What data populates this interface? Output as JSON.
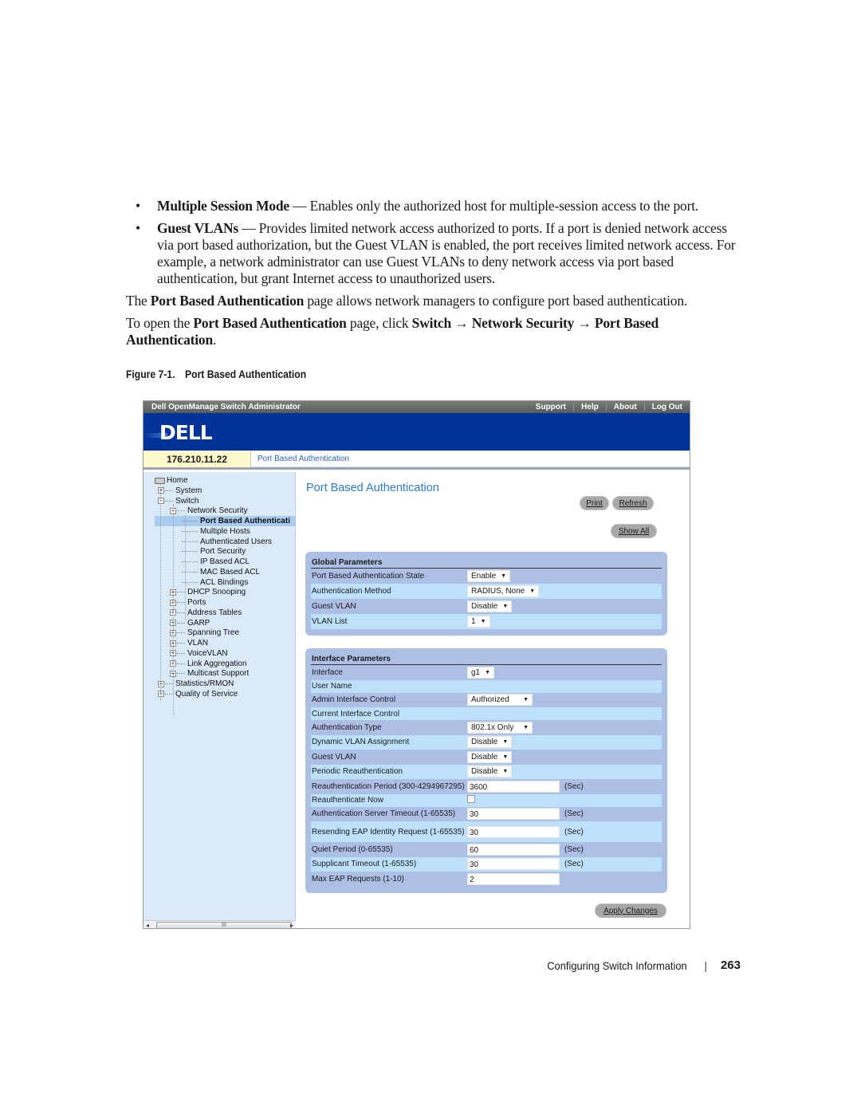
{
  "document": {
    "bullets": [
      {
        "term": "Multiple Session Mode",
        "text": " — Enables only the authorized host for multiple-session access to the port."
      },
      {
        "term": "Guest VLANs",
        "text": " — Provides limited network access authorized to ports. If a port is denied network access via port based authorization, but the Guest VLAN is enabled, the port receives limited network access. For example, a network administrator can use Guest VLANs to deny network access via port based authentication, but grant Internet access to unauthorized users."
      }
    ],
    "para1": {
      "prefix": "The ",
      "bold": "Port Based Authentication",
      "suffix": " page allows network managers to configure port based authentication."
    },
    "para2": {
      "prefix": "To open the ",
      "bold1": "Port Based Authentication",
      "mid": " page, click ",
      "path1": "Switch",
      "arrow": " → ",
      "path2": "Network Security",
      "path3": "Port Based Authentication",
      "end": "."
    },
    "figure_number": "Figure 7-1.",
    "figure_title": "Port Based Authentication"
  },
  "app": {
    "title": "Dell OpenManage Switch Administrator",
    "top_links": [
      "Support",
      "Help",
      "About",
      "Log Out"
    ],
    "logo": "DELL",
    "ip_address": "176.210.11.22",
    "breadcrumb": "Port Based Authentication"
  },
  "tree": {
    "items": [
      {
        "label": "Home",
        "level": 0,
        "icon": "home-icon"
      },
      {
        "label": "System",
        "level": 1,
        "expander": "+"
      },
      {
        "label": "Switch",
        "level": 1,
        "expander": "−"
      },
      {
        "label": "Network Security",
        "level": 2,
        "expander": "−"
      },
      {
        "label": "Port Based Authenticati",
        "level": 3,
        "selected": true
      },
      {
        "label": "Multiple Hosts",
        "level": 3
      },
      {
        "label": "Authenticated Users",
        "level": 3
      },
      {
        "label": "Port Security",
        "level": 3
      },
      {
        "label": "IP Based ACL",
        "level": 3
      },
      {
        "label": "MAC Based ACL",
        "level": 3
      },
      {
        "label": "ACL Bindings",
        "level": 3
      },
      {
        "label": "DHCP Snooping",
        "level": 2,
        "expander": "+"
      },
      {
        "label": "Ports",
        "level": 2,
        "expander": "+"
      },
      {
        "label": "Address Tables",
        "level": 2,
        "expander": "+"
      },
      {
        "label": "GARP",
        "level": 2,
        "expander": "+"
      },
      {
        "label": "Spanning Tree",
        "level": 2,
        "expander": "+"
      },
      {
        "label": "VLAN",
        "level": 2,
        "expander": "+"
      },
      {
        "label": "VoiceVLAN",
        "level": 2,
        "expander": "+"
      },
      {
        "label": "Link Aggregation",
        "level": 2,
        "expander": "+"
      },
      {
        "label": "Multicast Support",
        "level": 2,
        "expander": "+"
      },
      {
        "label": "Statistics/RMON",
        "level": 1,
        "expander": "+"
      },
      {
        "label": "Quality of Service",
        "level": 1,
        "expander": "+"
      }
    ],
    "scroll_thumb_glyph": "III"
  },
  "main": {
    "title": "Port Based Authentication",
    "buttons": {
      "print": "Print",
      "refresh": "Refresh",
      "show_all": "Show All",
      "apply": "Apply Changes"
    },
    "global_params": {
      "title": "Global Parameters",
      "rows": [
        {
          "label": "Port Based Authentication State",
          "type": "select",
          "value": "Enable"
        },
        {
          "label": "Authentication Method",
          "type": "select",
          "value": "RADIUS, None"
        },
        {
          "label": "Guest VLAN",
          "type": "select",
          "value": "Disable"
        },
        {
          "label": "VLAN List",
          "type": "select",
          "value": "1"
        }
      ]
    },
    "interface_params": {
      "title": "Interface Parameters",
      "rows": [
        {
          "label": "Interface",
          "type": "select",
          "value": "g1"
        },
        {
          "label": "User Name",
          "type": "text-readonly",
          "value": ""
        },
        {
          "label": "Admin Interface Control",
          "type": "select",
          "value": "Authorized"
        },
        {
          "label": "Current Interface Control",
          "type": "text-readonly",
          "value": ""
        },
        {
          "label": "Authentication Type",
          "type": "select",
          "value": "802.1x Only"
        },
        {
          "label": "Dynamic VLAN Assignment",
          "type": "select",
          "value": "Disable"
        },
        {
          "label": "Guest VLAN",
          "type": "select",
          "value": "Disable"
        },
        {
          "label": "Periodic Reauthentication",
          "type": "select",
          "value": "Disable"
        },
        {
          "label": "Reauthentication Period (300-4294967295)",
          "type": "input",
          "value": "3600",
          "unit": "(Sec)"
        },
        {
          "label": "Reauthenticate Now",
          "type": "checkbox",
          "checked": false
        },
        {
          "label": "Authentication Server Timeout (1-65535)",
          "type": "input",
          "value": "30",
          "unit": "(Sec)"
        },
        {
          "label": "Resending EAP Identity Request (1-65535)",
          "type": "input",
          "value": "30",
          "unit": "(Sec)"
        },
        {
          "label": "Quiet Period (0-65535)",
          "type": "input",
          "value": "60",
          "unit": "(Sec)"
        },
        {
          "label": "Supplicant Timeout (1-65535)",
          "type": "input",
          "value": "30",
          "unit": "(Sec)"
        },
        {
          "label": "Max EAP Requests (1-10)",
          "type": "input",
          "value": "2"
        }
      ]
    }
  },
  "footer": {
    "section": "Configuring Switch Information",
    "separator": "|",
    "page_number": "263"
  }
}
